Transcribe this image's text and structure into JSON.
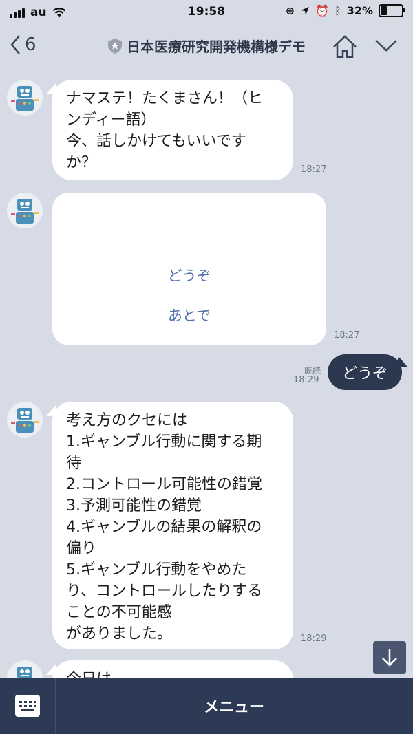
{
  "status_bar": {
    "carrier": "au",
    "time": "19:58",
    "battery": "32%",
    "battery_level": 0.32
  },
  "header": {
    "back_count": "6",
    "title": "日本医療研究開発機構様デモ"
  },
  "messages": [
    {
      "lines": [
        "ナマステ！たくまさん！（ヒ",
        "ンディー語）",
        "今、話しかけてもいいです",
        "か？"
      ],
      "time": "18:27"
    },
    {
      "options": [
        "どうぞ",
        "あとで"
      ],
      "time": "18:27"
    },
    {
      "text": "どうぞ",
      "read_label": "既読",
      "time": "18:29"
    },
    {
      "lines": [
        "考え方のクセには",
        "1.ギャンブル行動に関する期",
        "待",
        "2.コントロール可能性の錯覚",
        "3.予測可能性の錯覚",
        "4.ギャンブルの結果の解釈の",
        "偏り",
        "5.ギャンブル行動をやめた",
        "り、コントロールしたりする",
        "ことの不可能感",
        "がありました。"
      ],
      "time": "18:29"
    },
    {
      "partial_text": "今日は"
    }
  ],
  "bottom_bar": {
    "menu_label": "メニュー"
  }
}
